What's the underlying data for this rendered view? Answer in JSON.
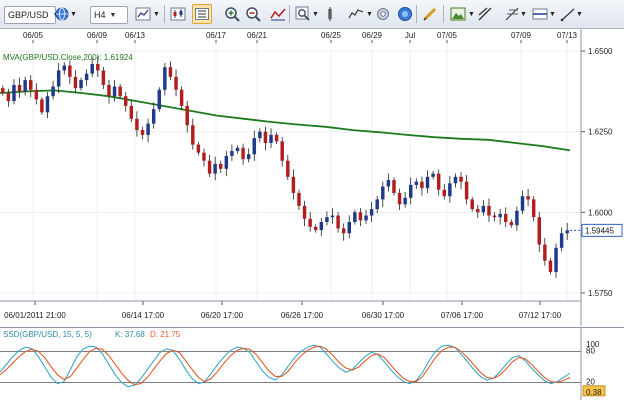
{
  "toolbar": {
    "symbol": "GBP/USD",
    "timeframe": "H4",
    "icons": [
      "globe-icon",
      "bar-chart-type-icon",
      "candle-chart-icon",
      "active-chart-style-icon",
      "zoom-in-icon",
      "zoom-out-icon",
      "indicator-icon",
      "search-icon",
      "insert-pointer-icon",
      "settings-gear-icon",
      "drawing-pencil-icon",
      "image-snapshot-icon",
      "line-tool-icon",
      "fibonacci-icon",
      "horizontal-line-icon",
      "trendline-icon"
    ]
  },
  "colors": {
    "up_candle": "#1f3a8a",
    "down_candle": "#b01e1e",
    "mva_line": "#1e7a1e",
    "stoch_k": "#3aa9c9",
    "stoch_d": "#e35a2c",
    "price_tag_border": "#2f62c9"
  },
  "chart_data": [
    {
      "type": "candlestick",
      "indicator_label": "MVA(GBP/USD.Close,200): 1.61924",
      "top_date_labels": [
        "06/05",
        "06/09",
        "06/13",
        "06/17",
        "06/21",
        "06/25",
        "06/29",
        "Jul",
        "07/05",
        "07/09",
        "07/13"
      ],
      "bottom_date_labels": [
        "06/01/2011 21:00",
        "06/14 17:00",
        "06/20 17:00",
        "06/26 17:00",
        "06/30 17:00",
        "07/06 17:00",
        "07/12 17:00"
      ],
      "y_tick_labels": [
        "1.6500",
        "1.6250",
        "1.6000",
        "1.5750"
      ],
      "ylim": [
        1.5725,
        1.6525
      ],
      "last_price_label": "1.59445",
      "grid": true,
      "series_close": [
        1.637,
        1.6345,
        1.6395,
        1.6375,
        1.641,
        1.638,
        1.635,
        1.631,
        1.636,
        1.639,
        1.644,
        1.6455,
        1.642,
        1.6385,
        1.641,
        1.643,
        1.646,
        1.644,
        1.6395,
        1.636,
        1.639,
        1.636,
        1.633,
        1.629,
        1.6255,
        1.624,
        1.6275,
        1.632,
        1.638,
        1.645,
        1.642,
        1.638,
        1.633,
        1.627,
        1.621,
        1.6185,
        1.616,
        1.612,
        1.615,
        1.6135,
        1.6175,
        1.619,
        1.62,
        1.6165,
        1.618,
        1.623,
        1.625,
        1.6215,
        1.624,
        1.622,
        1.616,
        1.611,
        1.606,
        1.602,
        1.598,
        1.5955,
        1.5945,
        1.597,
        1.5985,
        1.599,
        1.595,
        1.5935,
        1.597,
        1.6,
        1.5975,
        1.599,
        1.601,
        1.604,
        1.608,
        1.61,
        1.606,
        1.6025,
        1.6045,
        1.6085,
        1.6095,
        1.6075,
        1.611,
        1.612,
        1.607,
        1.605,
        1.609,
        1.611,
        1.6095,
        1.604,
        1.601,
        1.6,
        1.602,
        1.599,
        1.5985,
        1.5995,
        1.597,
        1.596,
        1.6005,
        1.605,
        1.604,
        1.5985,
        1.59,
        1.585,
        1.5815,
        1.589,
        1.5935,
        1.5944
      ],
      "mva_series": [
        1.637,
        1.6375,
        1.6378,
        1.637,
        1.636,
        1.6345,
        1.633,
        1.6315,
        1.63,
        1.629,
        1.628,
        1.6272,
        1.6265,
        1.6255,
        1.6248,
        1.624,
        1.6233,
        1.6228,
        1.6225,
        1.6215,
        1.6205,
        1.6192
      ]
    },
    {
      "type": "line",
      "indicator_label_prefix": "SSD(GBP/USD, 15, 5, 5)",
      "k_label": "K: 37.68",
      "d_label": "D: 21.75",
      "y_tick_labels": [
        "100",
        "80",
        "20",
        "0.38"
      ],
      "ylim": [
        0,
        100
      ],
      "levels": [
        80,
        20
      ],
      "series": [
        {
          "name": "K",
          "values": [
            40,
            55,
            70,
            82,
            88,
            85,
            70,
            50,
            30,
            18,
            22,
            45,
            70,
            85,
            90,
            88,
            75,
            55,
            35,
            20,
            12,
            15,
            28,
            45,
            62,
            78,
            85,
            82,
            65,
            45,
            28,
            18,
            22,
            38,
            55,
            70,
            82,
            88,
            86,
            78,
            60,
            42,
            30,
            25,
            35,
            52,
            68,
            80,
            88,
            92,
            88,
            75,
            60,
            48,
            40,
            45,
            58,
            70,
            78,
            74,
            60,
            45,
            32,
            22,
            18,
            24,
            40,
            62,
            80,
            90,
            92,
            88,
            75,
            60,
            45,
            32,
            25,
            28,
            40,
            55,
            68,
            72,
            62,
            48,
            35,
            24,
            18,
            22,
            30,
            38
          ]
        },
        {
          "name": "D",
          "values": [
            35,
            45,
            58,
            70,
            80,
            84,
            80,
            68,
            50,
            35,
            26,
            32,
            48,
            65,
            80,
            86,
            84,
            72,
            55,
            38,
            24,
            16,
            18,
            30,
            46,
            62,
            76,
            82,
            78,
            62,
            45,
            30,
            22,
            28,
            42,
            58,
            72,
            82,
            86,
            84,
            74,
            58,
            42,
            32,
            32,
            42,
            58,
            72,
            82,
            88,
            90,
            84,
            72,
            58,
            48,
            44,
            50,
            62,
            72,
            75,
            68,
            54,
            40,
            28,
            22,
            22,
            32,
            50,
            68,
            82,
            88,
            88,
            80,
            68,
            54,
            40,
            30,
            28,
            34,
            46,
            60,
            68,
            66,
            55,
            42,
            30,
            22,
            20,
            24,
            30
          ]
        }
      ]
    }
  ]
}
